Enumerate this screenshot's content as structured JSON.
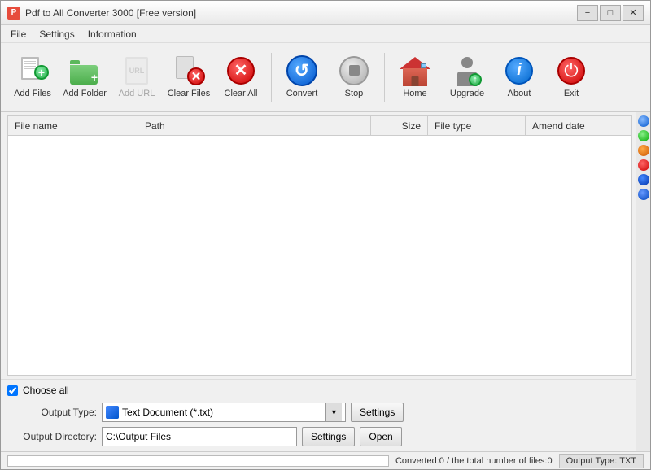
{
  "window": {
    "title": "Pdf to All Converter 3000 [Free version]"
  },
  "menu": {
    "items": [
      "File",
      "Settings",
      "Information"
    ]
  },
  "toolbar": {
    "buttons": [
      {
        "id": "add-files",
        "label": "Add Files",
        "disabled": false
      },
      {
        "id": "add-folder",
        "label": "Add Folder",
        "disabled": false
      },
      {
        "id": "add-url",
        "label": "Add URL",
        "disabled": true
      },
      {
        "id": "clear-files",
        "label": "Clear Files",
        "disabled": false
      },
      {
        "id": "clear-all",
        "label": "Clear All",
        "disabled": false
      },
      {
        "id": "convert",
        "label": "Convert",
        "disabled": false
      },
      {
        "id": "stop",
        "label": "Stop",
        "disabled": false
      },
      {
        "id": "home",
        "label": "Home",
        "disabled": false
      },
      {
        "id": "upgrade",
        "label": "Upgrade",
        "disabled": false
      },
      {
        "id": "about",
        "label": "About",
        "disabled": false
      },
      {
        "id": "exit",
        "label": "Exit",
        "disabled": false
      }
    ]
  },
  "table": {
    "columns": [
      "File name",
      "Path",
      "Size",
      "File type",
      "Amend date"
    ],
    "rows": []
  },
  "choose_all_label": "Choose all",
  "output": {
    "type_label": "Output Type:",
    "type_value": "Text Document (*.txt)",
    "settings_label": "Settings",
    "dir_label": "Output Directory:",
    "dir_value": "C:\\Output Files",
    "dir_settings_label": "Settings",
    "open_label": "Open"
  },
  "status": {
    "converted": "Converted:0  /  the total number of files:0",
    "output_type": "Output Type: TXT"
  }
}
